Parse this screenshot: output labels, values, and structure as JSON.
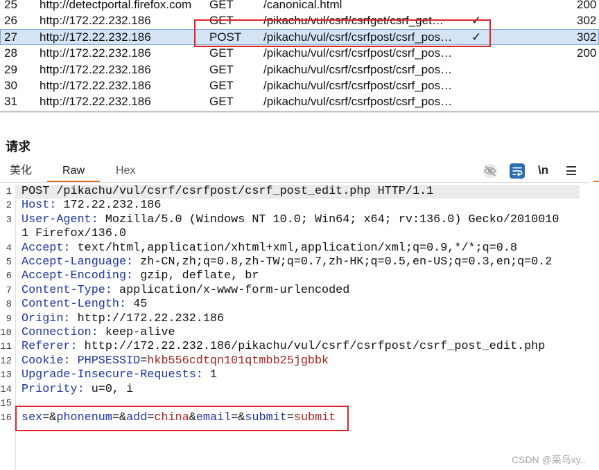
{
  "history": {
    "rows": [
      {
        "id": "25",
        "host": "http://detectportal.firefox.com",
        "method": "GET",
        "url": "/canonical.html",
        "status": "200"
      },
      {
        "id": "26",
        "host": "http://172.22.232.186",
        "method": "GET",
        "url": "/pikachu/vul/csrf/csrfget/csrf_get…",
        "edited": "✓",
        "status": "302"
      },
      {
        "id": "27",
        "host": "http://172.22.232.186",
        "method": "POST",
        "url": "/pikachu/vul/csrf/csrfpost/csrf_pos…",
        "edited": "✓",
        "status": "302",
        "selected": true
      },
      {
        "id": "28",
        "host": "http://172.22.232.186",
        "method": "GET",
        "url": "/pikachu/vul/csrf/csrfpost/csrf_pos…",
        "status": "200"
      },
      {
        "id": "29",
        "host": "http://172.22.232.186",
        "method": "GET",
        "url": "/pikachu/vul/csrf/csrfpost/csrf_pos…"
      },
      {
        "id": "30",
        "host": "http://172.22.232.186",
        "method": "GET",
        "url": "/pikachu/vul/csrf/csrfpost/csrf_pos…"
      },
      {
        "id": "31",
        "host": "http://172.22.232.186",
        "method": "GET",
        "url": "/pikachu/vul/csrf/csrfpost/csrf_pos…"
      }
    ]
  },
  "request": {
    "title": "请求",
    "tabs": [
      {
        "label": "美化",
        "active": false
      },
      {
        "label": "Raw",
        "active": true
      },
      {
        "label": "Hex",
        "active": false
      }
    ],
    "toolbar": {
      "newline_label": "\\n"
    },
    "lines": [
      {
        "n": "1",
        "tokens": [
          {
            "t": "POST /pikachu/vul/csrf/csrfpost/csrf_post_edit.php HTTP/1.1"
          }
        ]
      },
      {
        "n": "2",
        "tokens": [
          {
            "t": "Host:",
            "c": "#1c34a6"
          },
          {
            "t": " 172.22.232.186"
          }
        ]
      },
      {
        "n": "3",
        "tokens": [
          {
            "t": "User-Agent:",
            "c": "#1c34a6"
          },
          {
            "t": " Mozilla/5.0 (Windows NT 10.0; Win64; x64; rv:136.0) Gecko/20100101 Firefox/136.0"
          }
        ]
      },
      {
        "n": "4",
        "tokens": [
          {
            "t": "Accept:",
            "c": "#1c34a6"
          },
          {
            "t": " text/html,application/xhtml+xml,application/xml;q=0.9,*/*;q=0.8"
          }
        ]
      },
      {
        "n": "5",
        "tokens": [
          {
            "t": "Accept-Language:",
            "c": "#1c34a6"
          },
          {
            "t": " zh-CN,zh;q=0.8,zh-TW;q=0.7,zh-HK;q=0.5,en-US;q=0.3,en;q=0.2"
          }
        ]
      },
      {
        "n": "6",
        "tokens": [
          {
            "t": "Accept-Encoding:",
            "c": "#1c34a6"
          },
          {
            "t": " gzip, deflate, br"
          }
        ]
      },
      {
        "n": "7",
        "tokens": [
          {
            "t": "Content-Type:",
            "c": "#1c34a6"
          },
          {
            "t": " application/x-www-form-urlencoded"
          }
        ]
      },
      {
        "n": "8",
        "tokens": [
          {
            "t": "Content-Length:",
            "c": "#1c34a6"
          },
          {
            "t": " 45"
          }
        ]
      },
      {
        "n": "9",
        "tokens": [
          {
            "t": "Origin:",
            "c": "#1c34a6"
          },
          {
            "t": " http://172.22.232.186"
          }
        ]
      },
      {
        "n": "10",
        "tokens": [
          {
            "t": "Connection:",
            "c": "#1c34a6"
          },
          {
            "t": " keep-alive"
          }
        ]
      },
      {
        "n": "11",
        "tokens": [
          {
            "t": "Referer:",
            "c": "#1c34a6"
          },
          {
            "t": " http://172.22.232.186/pikachu/vul/csrf/csrfpost/csrf_post_edit.php"
          }
        ]
      },
      {
        "n": "12",
        "tokens": [
          {
            "t": "Cookie:",
            "c": "#1c34a6"
          },
          {
            "t": " "
          },
          {
            "t": "PHPSESSID",
            "c": "#1c34a6"
          },
          {
            "t": "="
          },
          {
            "t": "hkb556cdtqn101qtmbb25jgbbk",
            "c": "#a8251f"
          }
        ]
      },
      {
        "n": "13",
        "tokens": [
          {
            "t": "Upgrade-Insecure-Requests:",
            "c": "#1c34a6"
          },
          {
            "t": " 1"
          }
        ]
      },
      {
        "n": "14",
        "tokens": [
          {
            "t": "Priority:",
            "c": "#1c34a6"
          },
          {
            "t": " u=0, i"
          }
        ]
      },
      {
        "n": "15",
        "tokens": []
      },
      {
        "n": "16",
        "tokens": [
          {
            "t": "sex",
            "c": "#1c34a6"
          },
          {
            "t": "=&"
          },
          {
            "t": "phonenum",
            "c": "#1c34a6"
          },
          {
            "t": "=&"
          },
          {
            "t": "add",
            "c": "#1c34a6"
          },
          {
            "t": "="
          },
          {
            "t": "china",
            "c": "#a8251f"
          },
          {
            "t": "&"
          },
          {
            "t": "email",
            "c": "#1c34a6"
          },
          {
            "t": "=&"
          },
          {
            "t": "submit",
            "c": "#1c34a6"
          },
          {
            "t": "="
          },
          {
            "t": "submit",
            "c": "#a8251f"
          }
        ]
      }
    ]
  },
  "watermark": "CSDN @菜鸟xy..",
  "icons": {
    "hide_nonprintable": "eye-slash-icon",
    "wrap_lines": "word-wrap-icon",
    "menu": "hamburger-menu-icon"
  },
  "colors": {
    "header_name": "#1c34a6",
    "param_value": "#a8251f",
    "selected_row": "#d5e4f5",
    "tab_accent": "#e8702a",
    "annotation": "#dc2327",
    "wrap_button": "#2f6cb4"
  }
}
